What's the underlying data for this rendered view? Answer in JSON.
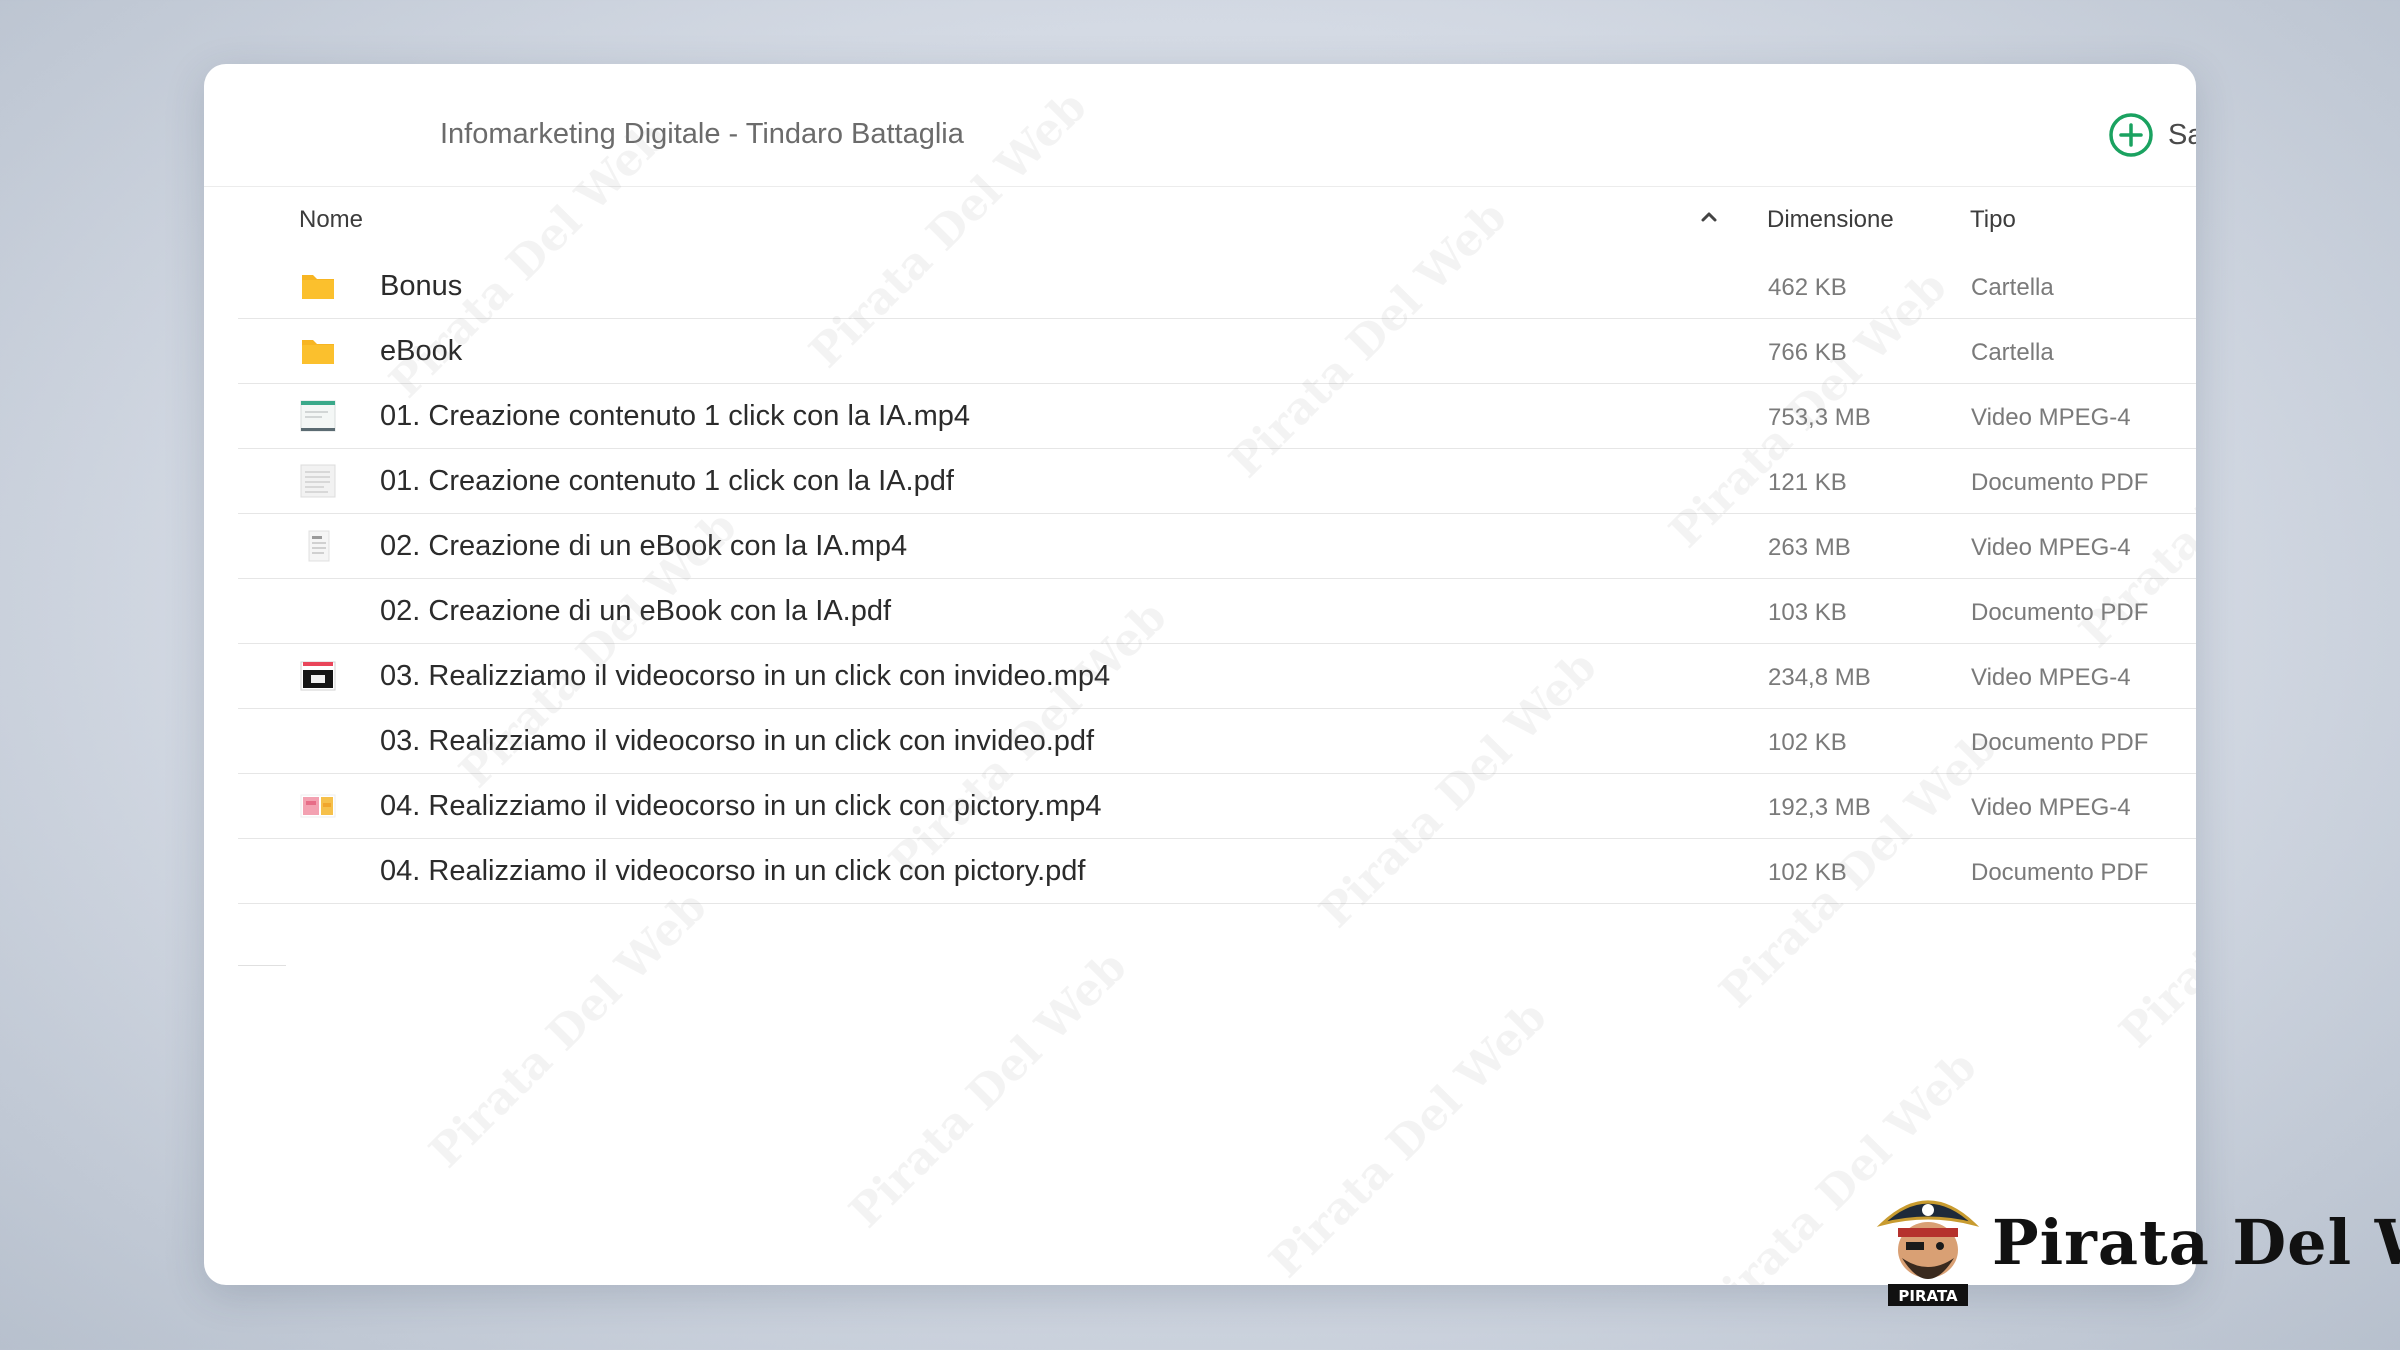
{
  "window": {
    "title": "Infomarketing Digitale - Tindaro Battaglia",
    "save_label": "Sa"
  },
  "columns": {
    "name": "Nome",
    "size": "Dimensione",
    "type": "Tipo"
  },
  "files": [
    {
      "name": "Bonus",
      "size": "462 KB",
      "type": "Cartella",
      "icon": "folder-icon"
    },
    {
      "name": "eBook",
      "size": "766 KB",
      "type": "Cartella",
      "icon": "folder-icon"
    },
    {
      "name": "01. Creazione contenuto 1 click con la IA.mp4",
      "size": "753,3 MB",
      "type": "Video MPEG-4",
      "icon": "video-thumbnail-icon"
    },
    {
      "name": "01. Creazione contenuto 1 click con la IA.pdf",
      "size": "121 KB",
      "type": "Documento PDF",
      "icon": "pdf-thumbnail-icon"
    },
    {
      "name": "02. Creazione di un eBook con la IA.mp4",
      "size": "263 MB",
      "type": "Video MPEG-4",
      "icon": "video-thumbnail-icon"
    },
    {
      "name": "02. Creazione di un eBook con la IA.pdf",
      "size": "103 KB",
      "type": "Documento PDF",
      "icon": "none"
    },
    {
      "name": "03. Realizziamo il videocorso in un click con invideo.mp4",
      "size": "234,8 MB",
      "type": "Video MPEG-4",
      "icon": "video-thumbnail-icon"
    },
    {
      "name": "03. Realizziamo il videocorso in un click con invideo.pdf",
      "size": "102 KB",
      "type": "Documento PDF",
      "icon": "none"
    },
    {
      "name": "04. Realizziamo il videocorso in un click con pictory.mp4",
      "size": "192,3 MB",
      "type": "Video MPEG-4",
      "icon": "video-thumbnail-icon"
    },
    {
      "name": "04. Realizziamo il videocorso in un click con pictory.pdf",
      "size": "102 KB",
      "type": "Documento PDF",
      "icon": "none"
    }
  ],
  "watermark": {
    "text": "Pirata Del Web"
  },
  "logo": {
    "text": "Pirata Del Web",
    "badge": "PIRATA"
  },
  "colors": {
    "accent": "#1aa260",
    "folder": "#f7b522"
  }
}
